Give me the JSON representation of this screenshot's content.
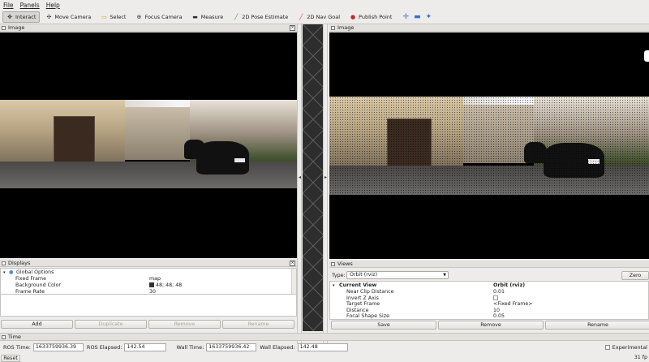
{
  "menu": [
    "File",
    "Panels",
    "Help"
  ],
  "toolbar": [
    {
      "label": "Interact",
      "icon": "interact-icon",
      "glyph": "✥",
      "active": true,
      "color": "#333333"
    },
    {
      "label": "Move Camera",
      "icon": "move-camera-icon",
      "glyph": "✣",
      "active": false,
      "color": "#333333"
    },
    {
      "label": "Select",
      "icon": "select-icon",
      "glyph": "▭",
      "active": false,
      "color": "#c8a400"
    },
    {
      "label": "Focus Camera",
      "icon": "focus-camera-icon",
      "glyph": "⊕",
      "active": false,
      "color": "#333333"
    },
    {
      "label": "Measure",
      "icon": "measure-icon",
      "glyph": "▬",
      "active": false,
      "color": "#333333"
    },
    {
      "label": "2D Pose Estimate",
      "icon": "pose-estimate-icon",
      "glyph": "╱",
      "active": false,
      "color": "#2e9e2e"
    },
    {
      "label": "2D Nav Goal",
      "icon": "nav-goal-icon",
      "glyph": "╱",
      "active": false,
      "color": "#c02ec0"
    },
    {
      "label": "Publish Point",
      "icon": "publish-point-icon",
      "glyph": "●",
      "active": false,
      "color": "#d02020"
    }
  ],
  "left_image_panel": {
    "title": "Image"
  },
  "right_image_panel": {
    "title": "Image"
  },
  "displays": {
    "title": "Displays",
    "rows": [
      {
        "key": "Global Options",
        "value": "",
        "indent": 0
      },
      {
        "key": "Fixed Frame",
        "value": "map",
        "indent": 1
      },
      {
        "key": "Background Color",
        "value": "48; 48; 48",
        "indent": 1
      },
      {
        "key": "Frame Rate",
        "value": "30",
        "indent": 1
      }
    ],
    "buttons": [
      {
        "label": "Add",
        "enabled": true
      },
      {
        "label": "Duplicate",
        "enabled": false
      },
      {
        "label": "Remove",
        "enabled": false
      },
      {
        "label": "Rename",
        "enabled": false
      }
    ]
  },
  "views": {
    "title": "Views",
    "type_label": "Type:",
    "type_value": "Orbit (rviz)",
    "zero_label": "Zero",
    "current_view": {
      "key": "Current View",
      "value": "Orbit (rviz)"
    },
    "rows": [
      {
        "key": "Near Clip Distance",
        "value": "0.01"
      },
      {
        "key": "Invert Z Axis",
        "value": ""
      },
      {
        "key": "Target Frame",
        "value": "<Fixed Frame>"
      },
      {
        "key": "Distance",
        "value": "10"
      },
      {
        "key": "Focal Shape Size",
        "value": "0.05"
      }
    ],
    "buttons": [
      "Save",
      "Remove",
      "Rename"
    ]
  },
  "time": {
    "title": "Time",
    "ros_time_label": "ROS Time:",
    "ros_time": "1633759936.39",
    "ros_elapsed_label": "ROS Elapsed:",
    "ros_elapsed": "142.54",
    "wall_time_label": "Wall Time:",
    "wall_time": "1633759936.42",
    "wall_elapsed_label": "Wall Elapsed:",
    "wall_elapsed": "142.48",
    "experimental_label": "Experimental"
  },
  "status": {
    "reset_label": "Reset",
    "fps": "31 fp"
  }
}
